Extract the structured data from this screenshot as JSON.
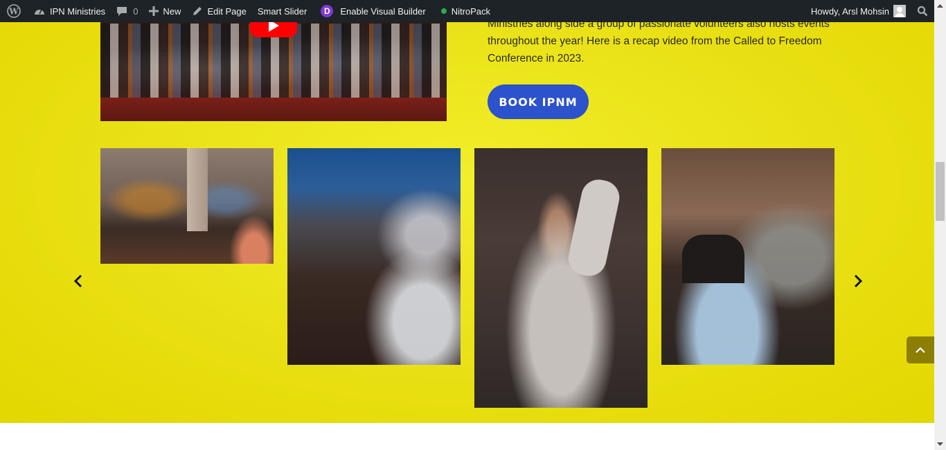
{
  "adminbar": {
    "wp_logo": "wordpress-logo-icon",
    "site_name": "IPN Ministries",
    "comments_count": "0",
    "new_label": "New",
    "edit_page_label": "Edit Page",
    "smart_slider_label": "Smart Slider",
    "visual_builder_label": "Enable Visual Builder",
    "visual_builder_badge": "D",
    "nitropack_label": "NitroPack",
    "howdy_label": "Howdy, Arsl Mohsin"
  },
  "section": {
    "description_lines": [
      "Ministries along side a group of passionate volunteers also hosts events",
      "throughout the year! Here is a recap video from the Called to Freedom",
      "Conference in 2023."
    ],
    "book_button_label": "BOOK IPNM",
    "video": {
      "provider": "YouTube",
      "play_icon": "youtube-play-icon"
    },
    "gallery": [
      {
        "alt": "Worship band performing on stage"
      },
      {
        "alt": "Congregation praying under blue lights"
      },
      {
        "alt": "Singer with raised hand and microphone"
      },
      {
        "alt": "Pastor praying with a congregant"
      }
    ]
  },
  "colors": {
    "section_yellow": "#e9e014",
    "button_blue": "#2c52cc",
    "admin_bar": "#1d2327",
    "to_top_bg": "#8b7e00",
    "youtube_red": "#ff0000"
  }
}
